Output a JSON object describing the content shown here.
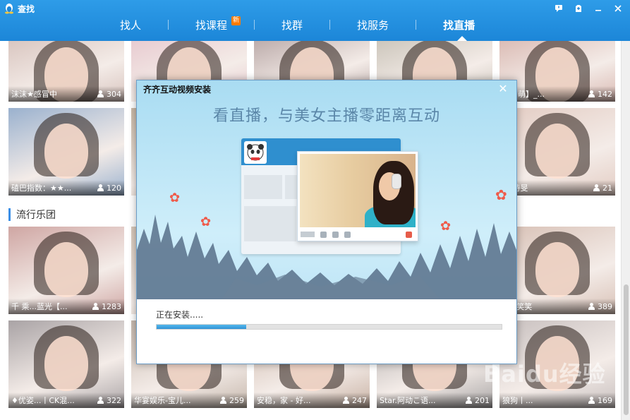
{
  "window": {
    "title": "查找",
    "controls": [
      "feedback-icon",
      "skin-icon",
      "minimize-icon",
      "close-icon"
    ]
  },
  "nav": {
    "tabs": [
      {
        "label": "找人",
        "badge": ""
      },
      {
        "label": "找课程",
        "badge": "新"
      },
      {
        "label": "找群",
        "badge": ""
      },
      {
        "label": "找服务",
        "badge": ""
      },
      {
        "label": "找直播",
        "badge": ""
      }
    ],
    "active_index": 4
  },
  "section": {
    "title": "流行乐团"
  },
  "tiles": [
    {
      "name": "沫沫★感冒中",
      "viewers": "304",
      "color": "#d7c3bd"
    },
    {
      "name": "",
      "viewers": "",
      "color": "#e7c9cf"
    },
    {
      "name": "",
      "viewers": "",
      "color": "#b8a7a6"
    },
    {
      "name": "",
      "viewers": "",
      "color": "#c9c3b8"
    },
    {
      "name": "春山萌】_...",
      "viewers": "142",
      "color": "#d9b8b1"
    },
    {
      "name": "磕巴指数：★★...",
      "viewers": "120",
      "color": "#9ab1ce"
    },
    {
      "name": "",
      "viewers": "",
      "color": "#c8b7a5"
    },
    {
      "name": "",
      "viewers": "",
      "color": "#b7a495"
    },
    {
      "name": "",
      "viewers": "",
      "color": "#bfae9c"
    },
    {
      "name": "丿 诗旻",
      "viewers": "21",
      "color": "#e3ccc3"
    },
    {
      "name": "千 乘...蓝光【...",
      "viewers": "1283",
      "color": "#cfa6a3"
    },
    {
      "name": "",
      "viewers": "",
      "color": "#d6c6b8"
    },
    {
      "name": "",
      "viewers": "",
      "color": "#b6a99e"
    },
    {
      "name": "",
      "viewers": "",
      "color": "#c1b2a6"
    },
    {
      "name": "乞~笑笑",
      "viewers": "389",
      "color": "#d8c1b6"
    },
    {
      "name": "♦优姿...丨CK混...",
      "viewers": "322",
      "color": "#a9a3a5"
    },
    {
      "name": "华宴娱乐-宝儿...",
      "viewers": "259",
      "color": "#c6b8ad"
    },
    {
      "name": "安稳，家 - 好...",
      "viewers": "247",
      "color": "#c9b3a5"
    },
    {
      "name": "Star.阿动こ语...",
      "viewers": "201",
      "color": "#a9a6a6"
    },
    {
      "name": "狼狗丨...",
      "viewers": "169",
      "color": "#c8c0bf"
    }
  ],
  "dialog": {
    "title": "齐齐互动视频安装",
    "slogan": "看直播，与美女主播零距离互动",
    "status": "正在安装.....",
    "progress": 0.26,
    "watermark": "Baidu经验"
  }
}
